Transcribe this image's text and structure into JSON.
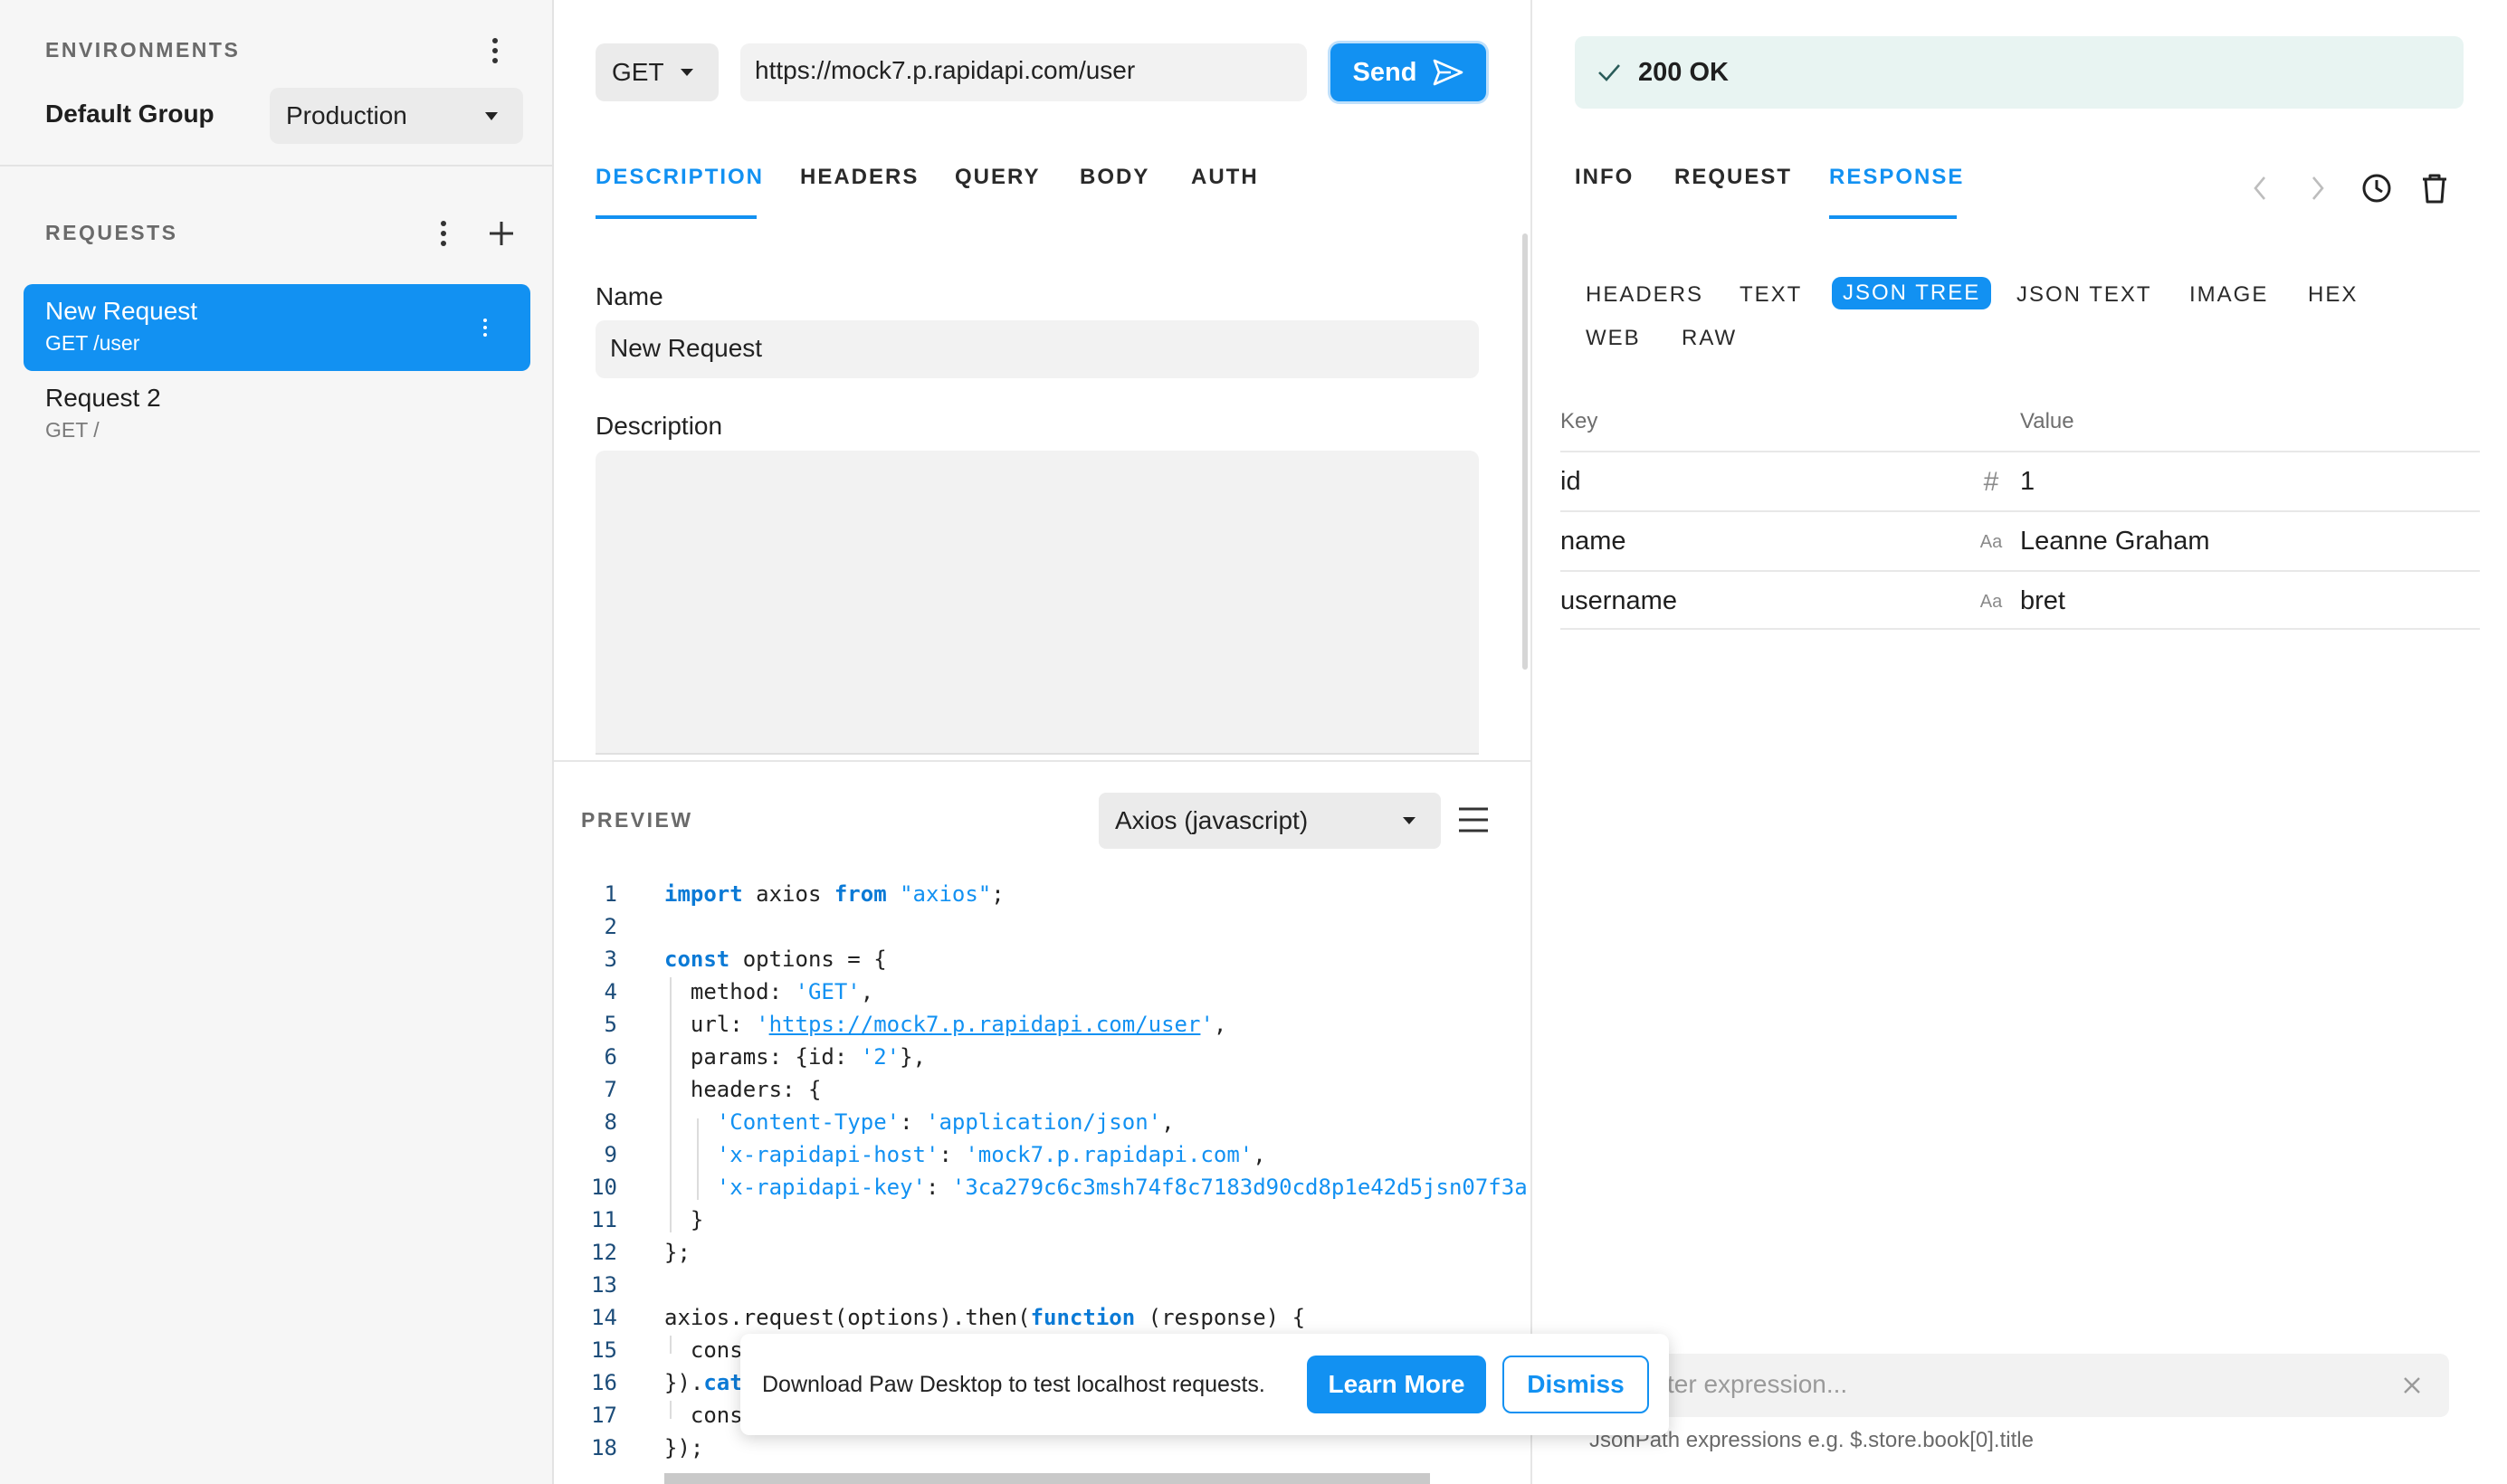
{
  "sidebar": {
    "environments_title": "ENVIRONMENTS",
    "group_label": "Default Group",
    "environment_selected": "Production",
    "requests_title": "REQUESTS",
    "requests": [
      {
        "name": "New Request",
        "sub": "GET /user"
      },
      {
        "name": "Request 2",
        "sub": "GET /"
      }
    ]
  },
  "request": {
    "method": "GET",
    "url": "https://mock7.p.rapidapi.com/user",
    "send_label": "Send",
    "tabs": [
      "DESCRIPTION",
      "HEADERS",
      "QUERY",
      "BODY",
      "AUTH"
    ],
    "name_label": "Name",
    "name_value": "New Request",
    "description_label": "Description",
    "description_value": ""
  },
  "preview": {
    "title": "PREVIEW",
    "language": "Axios (javascript)",
    "code_lines": [
      "import axios from \"axios\";",
      "",
      "const options = {",
      "  method: 'GET',",
      "  url: 'https://mock7.p.rapidapi.com/user',",
      "  params: {id: '2'},",
      "  headers: {",
      "    'Content-Type': 'application/json',",
      "    'x-rapidapi-host': 'mock7.p.rapidapi.com',",
      "    'x-rapidapi-key': '3ca279c6c3msh74f8c7183d90cd8p1e42d5jsn07f3a",
      "  }",
      "};",
      "",
      "axios.request(options).then(function (response) {",
      "  cons",
      "}).cat",
      "  cons",
      "});"
    ]
  },
  "response": {
    "status": "200 OK",
    "tabs": [
      "INFO",
      "REQUEST",
      "RESPONSE"
    ],
    "subtabs": [
      "HEADERS",
      "TEXT",
      "JSON TREE",
      "JSON TEXT",
      "IMAGE",
      "HEX",
      "WEB",
      "RAW"
    ],
    "table_headers": {
      "key": "Key",
      "value": "Value"
    },
    "rows": [
      {
        "key": "id",
        "type": "#",
        "value": "1"
      },
      {
        "key": "name",
        "type": "Aa",
        "value": "Leanne Graham"
      },
      {
        "key": "username",
        "type": "Aa",
        "value": "bret"
      }
    ],
    "filter_placeholder": "ter expression...",
    "filter_hint": "JsonPath expressions e.g. $.store.book[0].title"
  },
  "banner": {
    "message": "Download Paw Desktop to test localhost requests.",
    "learn_more": "Learn More",
    "dismiss": "Dismiss"
  },
  "colors": {
    "accent": "#1291f2",
    "status_bg": "#e8f4f2"
  }
}
